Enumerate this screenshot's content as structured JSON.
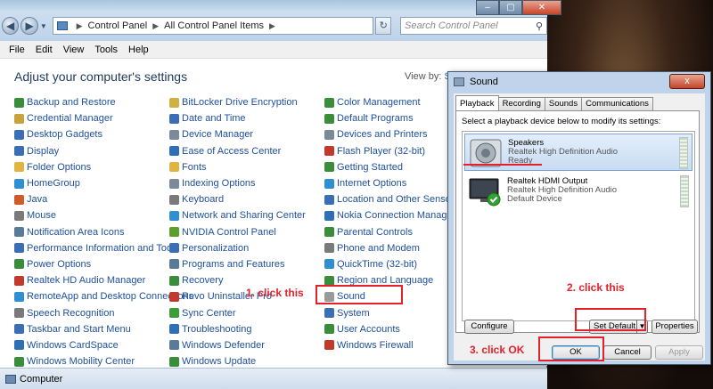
{
  "window": {
    "address": [
      "Control Panel",
      "All Control Panel Items"
    ],
    "search_placeholder": "Search Control Panel"
  },
  "menu": [
    "File",
    "Edit",
    "View",
    "Tools",
    "Help"
  ],
  "heading": "Adjust your computer's settings",
  "view_by": {
    "label": "View by:",
    "value": "Sm"
  },
  "columns": [
    [
      {
        "label": "Backup and Restore",
        "color": "#3a8d3a"
      },
      {
        "label": "Credential Manager",
        "color": "#c8a23a"
      },
      {
        "label": "Desktop Gadgets",
        "color": "#3a6fb5"
      },
      {
        "label": "Display",
        "color": "#3a6fb5"
      },
      {
        "label": "Folder Options",
        "color": "#e0b440"
      },
      {
        "label": "HomeGroup",
        "color": "#2f8fd0"
      },
      {
        "label": "Java",
        "color": "#d05a2a"
      },
      {
        "label": "Mouse",
        "color": "#7a7a7a"
      },
      {
        "label": "Notification Area Icons",
        "color": "#5a7a9a"
      },
      {
        "label": "Performance Information and Tools",
        "color": "#3a6fb5"
      },
      {
        "label": "Power Options",
        "color": "#3a8d3a"
      },
      {
        "label": "Realtek HD Audio Manager",
        "color": "#c0392b"
      },
      {
        "label": "RemoteApp and Desktop Connections",
        "color": "#2f8fd0"
      },
      {
        "label": "Speech Recognition",
        "color": "#7a7a7a"
      },
      {
        "label": "Taskbar and Start Menu",
        "color": "#3a6fb5"
      },
      {
        "label": "Windows CardSpace",
        "color": "#2f6fb5"
      },
      {
        "label": "Windows Mobility Center",
        "color": "#3a8d3a"
      }
    ],
    [
      {
        "label": "BitLocker Drive Encryption",
        "color": "#d0b040"
      },
      {
        "label": "Date and Time",
        "color": "#3a6fb5"
      },
      {
        "label": "Device Manager",
        "color": "#7a8a9a"
      },
      {
        "label": "Ease of Access Center",
        "color": "#2f6fb5"
      },
      {
        "label": "Fonts",
        "color": "#e0b440"
      },
      {
        "label": "Indexing Options",
        "color": "#7a8a9a"
      },
      {
        "label": "Keyboard",
        "color": "#7a7a7a"
      },
      {
        "label": "Network and Sharing Center",
        "color": "#2f8fd0"
      },
      {
        "label": "NVIDIA Control Panel",
        "color": "#5aa02a"
      },
      {
        "label": "Personalization",
        "color": "#3a6fb5"
      },
      {
        "label": "Programs and Features",
        "color": "#5a7a9a"
      },
      {
        "label": "Recovery",
        "color": "#3a8d3a"
      },
      {
        "label": "Revo Uninstaller Pro",
        "color": "#c0392b"
      },
      {
        "label": "Sync Center",
        "color": "#3a9d3a"
      },
      {
        "label": "Troubleshooting",
        "color": "#2f6fb5"
      },
      {
        "label": "Windows Defender",
        "color": "#5a7a9a"
      },
      {
        "label": "Windows Update",
        "color": "#3a8d3a"
      }
    ],
    [
      {
        "label": "Color Management",
        "color": "#3a8d3a"
      },
      {
        "label": "Default Programs",
        "color": "#3a8d3a"
      },
      {
        "label": "Devices and Printers",
        "color": "#7a8a9a"
      },
      {
        "label": "Flash Player (32-bit)",
        "color": "#c0392b"
      },
      {
        "label": "Getting Started",
        "color": "#3a8d3a"
      },
      {
        "label": "Internet Options",
        "color": "#2f8fd0"
      },
      {
        "label": "Location and Other Sensors",
        "color": "#3a6fb5"
      },
      {
        "label": "Nokia Connection Manager (32-bi",
        "color": "#2f6fb5"
      },
      {
        "label": "Parental Controls",
        "color": "#3a8d3a"
      },
      {
        "label": "Phone and Modem",
        "color": "#7a7a7a"
      },
      {
        "label": "QuickTime (32-bit)",
        "color": "#2f8fd0"
      },
      {
        "label": "Region and Language",
        "color": "#3a8d3a"
      },
      {
        "label": "Sound",
        "color": "#9a9a9a"
      },
      {
        "label": "System",
        "color": "#3a6fb5"
      },
      {
        "label": "User Accounts",
        "color": "#3a8d3a"
      },
      {
        "label": "Windows Firewall",
        "color": "#c0392b"
      }
    ]
  ],
  "status_bar": "Computer",
  "dialog": {
    "title": "Sound",
    "close": "x",
    "tabs": [
      "Playback",
      "Recording",
      "Sounds",
      "Communications"
    ],
    "instruction": "Select a playback device below to modify its settings:",
    "devices": [
      {
        "name": "Speakers",
        "driver": "Realtek High Definition Audio",
        "status": "Ready"
      },
      {
        "name": "Realtek HDMI Output",
        "driver": "Realtek High Definition Audio",
        "status": "Default Device"
      }
    ],
    "configure": "Configure",
    "set_default": "Set Default",
    "properties": "Properties",
    "ok": "OK",
    "cancel": "Cancel",
    "apply": "Apply"
  },
  "annotations": {
    "step1": "1. click this",
    "step2": "2. click this",
    "step3": "3. click OK"
  },
  "colors": {
    "annotation": "#e4202a",
    "link": "#1e4f9a",
    "heading": "#1e395b"
  }
}
